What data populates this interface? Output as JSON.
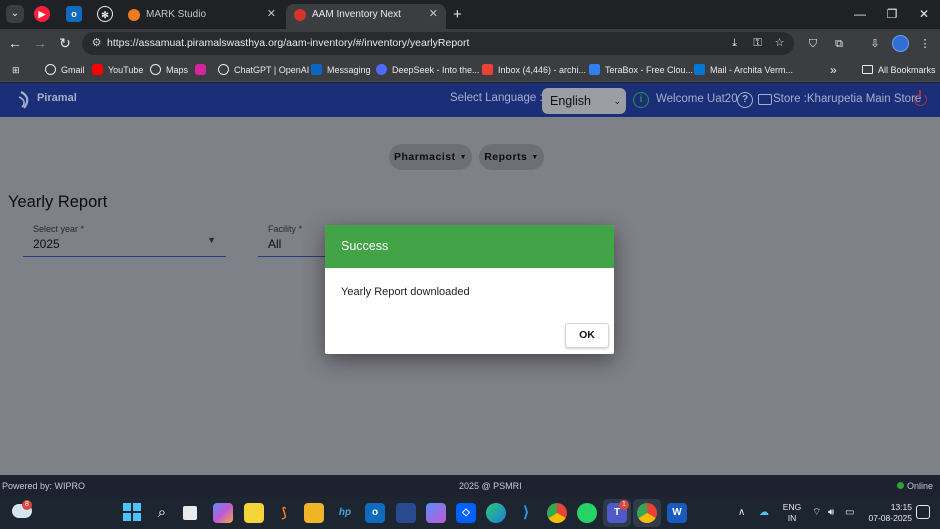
{
  "browser": {
    "tabs": [
      {
        "title": "MARK Studio",
        "active": false
      },
      {
        "title": "AAM Inventory Next",
        "active": true
      }
    ],
    "url": "https://assamuat.piramalswasthya.org/aam-inventory/#/inventory/yearlyReport",
    "bookmarks": [
      {
        "label": "Gmail",
        "color": "#e8eaed"
      },
      {
        "label": "YouTube",
        "color": "#ff0000"
      },
      {
        "label": "Maps",
        "color": "#e8eaed"
      },
      {
        "label": "",
        "color": "#d6249f"
      },
      {
        "label": "ChatGPT | OpenAI",
        "color": "#e8eaed"
      },
      {
        "label": "Messaging",
        "color": "#0a66c2"
      },
      {
        "label": "DeepSeek - Into the...",
        "color": "#4d6bfe"
      },
      {
        "label": "Inbox (4,446) - archi...",
        "color": "#ea4335"
      },
      {
        "label": "TeraBox - Free Clou...",
        "color": "#2f80ed"
      },
      {
        "label": "Mail - Archita Verm...",
        "color": "#0078d4"
      }
    ],
    "bookmarks_overflow": "»",
    "all_bookmarks": "All Bookmarks"
  },
  "app": {
    "logo_text": "Piramal",
    "select_language_label": "Select Language :",
    "language": "English",
    "welcome": "Welcome Uat20",
    "store": "Store :Kharupetia Main Store",
    "menu": [
      "Pharmacist",
      "Reports"
    ],
    "page_title": "Yearly Report",
    "year_field": {
      "label": "Select year *",
      "value": "2025"
    },
    "facility_field": {
      "label": "Facility *",
      "value": "All"
    }
  },
  "dialog": {
    "title": "Success",
    "message": "Yearly Report downloaded",
    "ok_label": "OK",
    "header_color": "#43a447"
  },
  "footer": {
    "left": "Powered by: WIPRO",
    "center": "2025 @ PSMRI",
    "status": "Online"
  },
  "taskbar": {
    "weather_badge": "8",
    "teams_badge": "1",
    "lang_line1": "ENG",
    "lang_line2": "IN",
    "time": "13:15",
    "date": "07-08-2025"
  }
}
